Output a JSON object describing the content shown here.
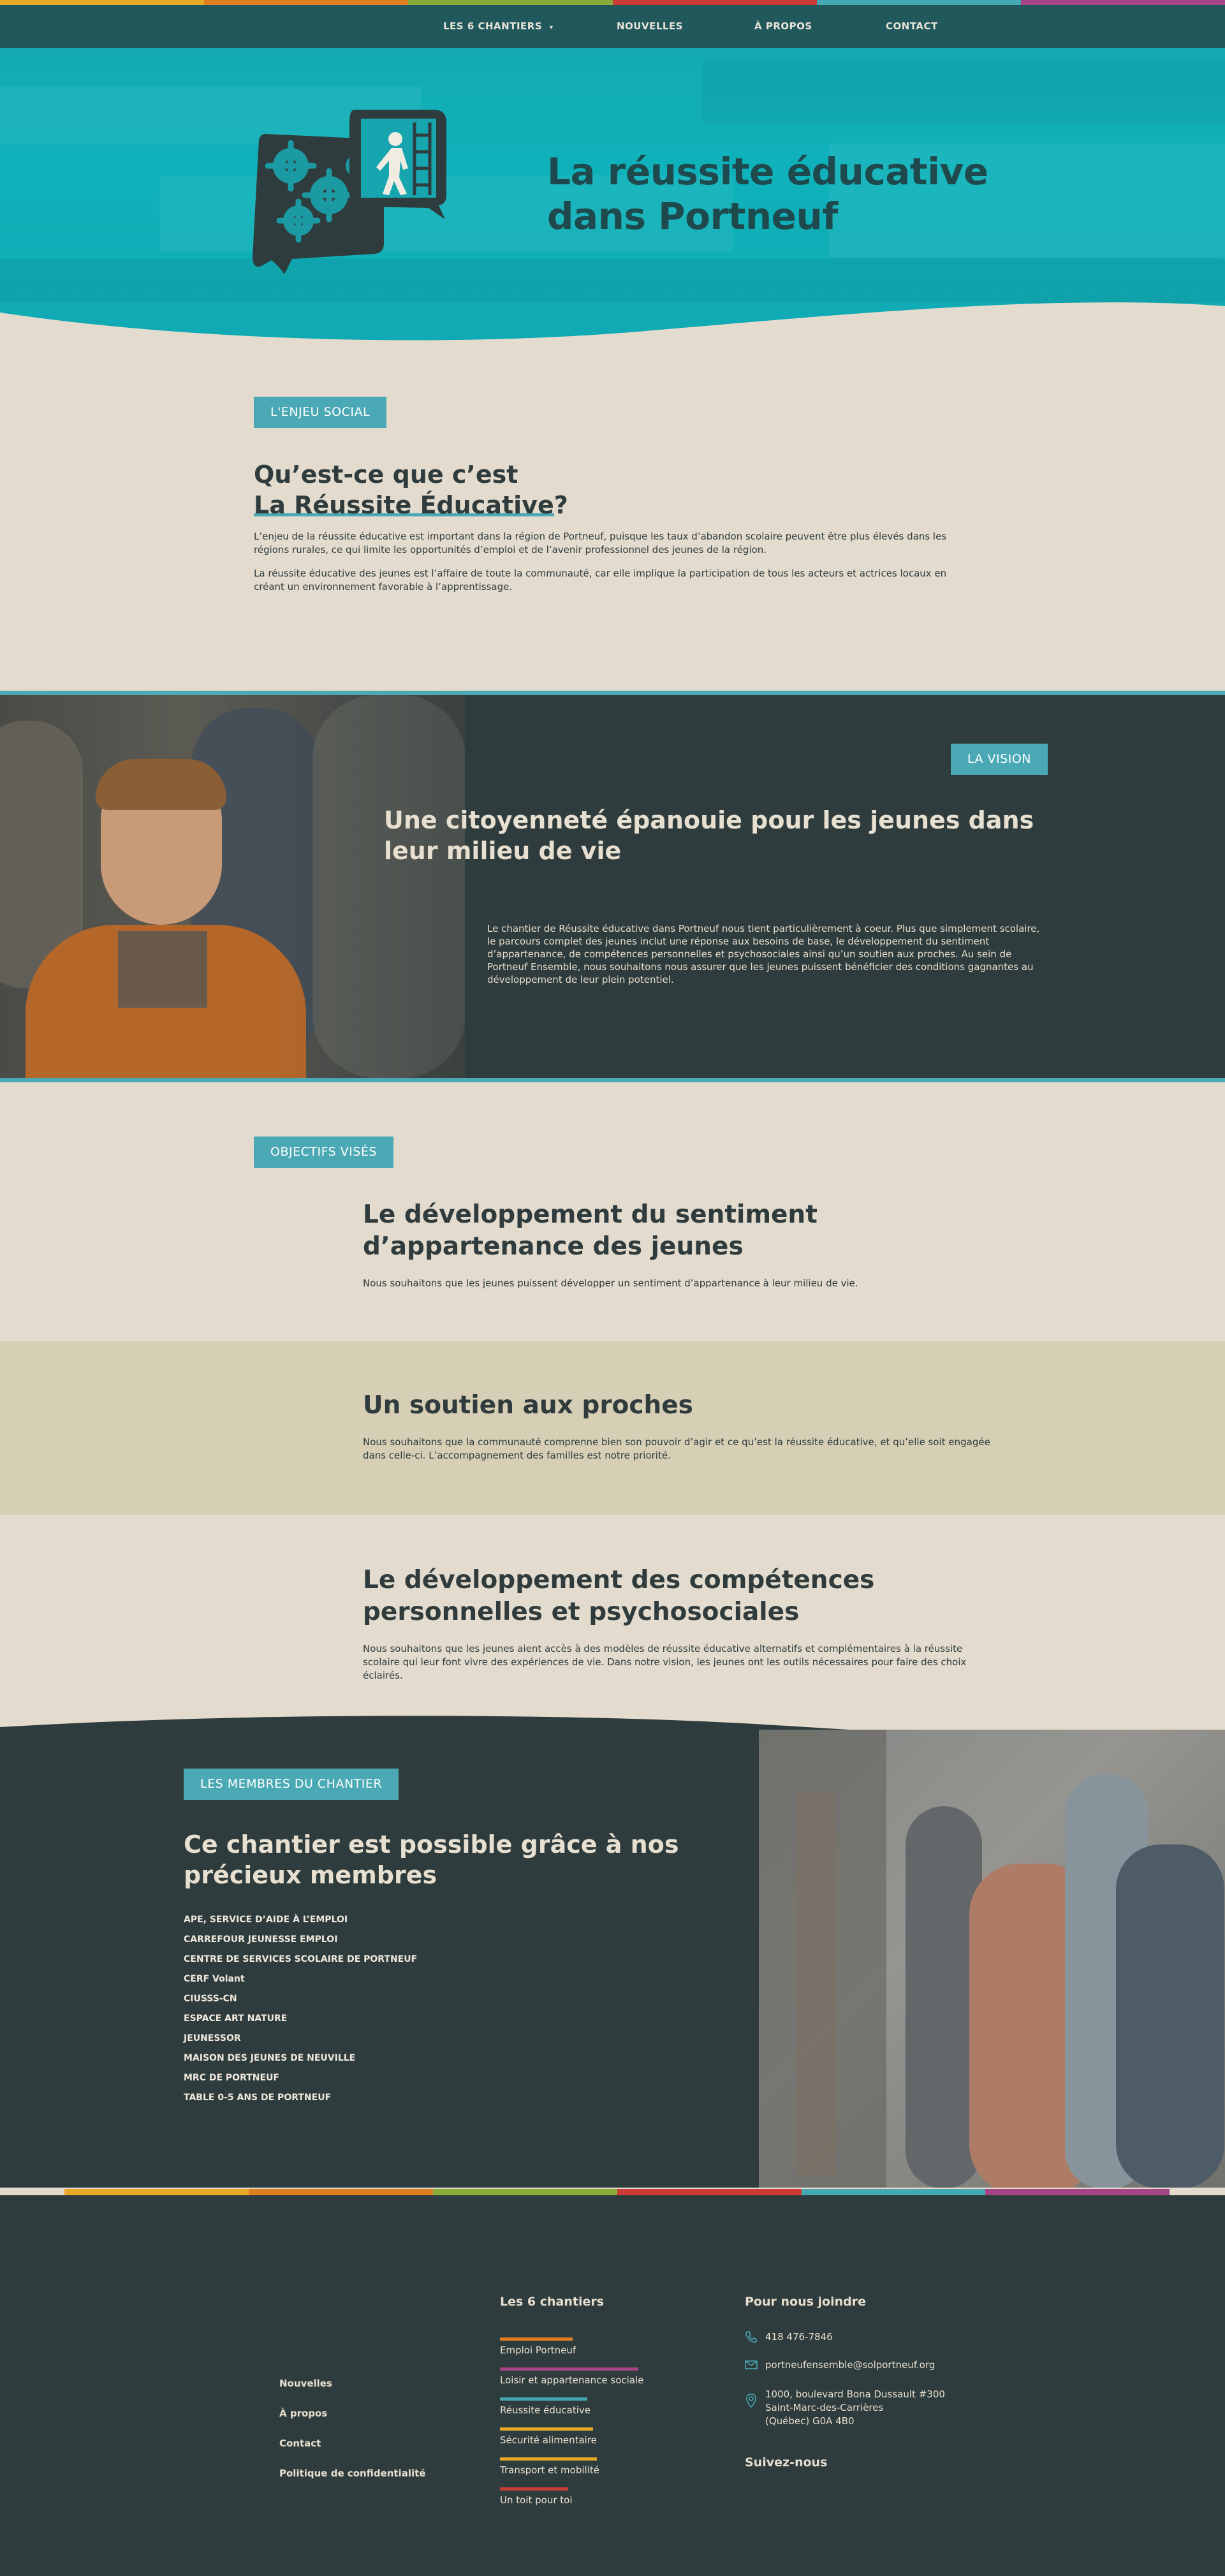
{
  "colors": {
    "stripe": [
      "#e9a928",
      "#e07f22",
      "#8aab3a",
      "#cc3b36",
      "#45a9b4",
      "#a54585"
    ],
    "teal": "#4aa9b4",
    "dark": "#2f3c3d",
    "beige": "#e3dbcd"
  },
  "nav": {
    "items": [
      {
        "label": "LES 6 CHANTIERS",
        "has_dropdown": true
      },
      {
        "label": "NOUVELLES"
      },
      {
        "label": "À PROPOS"
      },
      {
        "label": "CONTACT"
      }
    ]
  },
  "hero": {
    "logo_icon": "speech-bubbles-gears-ladder-icon",
    "title_line1": "La réussite éducative",
    "title_line2": "dans Portneuf"
  },
  "enjeu": {
    "tag": "L'ENJEU SOCIAL",
    "title_line1": "Qu’est-ce que c’est",
    "title_line2_highlight": "La Réussite Éducative",
    "title_line2_end": "?",
    "p1": "L’enjeu de la réussite éducative est important dans la région de Portneuf, puisque les taux d’abandon scolaire peuvent être plus élevés dans les régions rurales, ce qui limite les opportunités d’emploi et de l’avenir professionnel des jeunes de la région.",
    "p2": "La réussite éducative des jeunes est l’affaire de toute la communauté, car elle implique la participation de tous les acteurs et actrices locaux en créant un environnement favorable à l’apprentissage."
  },
  "vision": {
    "tag": "LA VISION",
    "title": "Une citoyenneté épanouie pour les jeunes dans leur milieu de vie",
    "body": "Le chantier de Réussite éducative dans Portneuf nous tient particulièrement à coeur. Plus que simplement scolaire, le parcours complet des jeunes inclut une réponse aux besoins de base, le développement du sentiment d’appartenance, de compétences personnelles et psychosociales ainsi qu’un soutien aux proches. Au sein de Portneuf Ensemble, nous souhaitons nous assurer que les jeunes puissent bénéficier des conditions gagnantes au développement de leur plein potentiel."
  },
  "objectifs": {
    "tag": "OBJECTIFS VISÉS",
    "items": [
      {
        "title": "Le développement du sentiment d’appartenance des jeunes",
        "body": "Nous souhaitons que les jeunes puissent développer un sentiment d’appartenance à leur milieu de vie."
      },
      {
        "title": "Un soutien aux proches",
        "body": "Nous souhaitons que la communauté comprenne bien son pouvoir d’agir et ce qu’est la réussite éducative, et qu’elle soit engagée dans celle-ci. L’accompagnement des familles est notre priorité."
      },
      {
        "title": "Le développement des compétences personnelles et psychosociales",
        "body": "Nous souhaitons que les jeunes aient accès à des modèles de réussite éducative alternatifs et complémentaires à la réussite scolaire qui leur font vivre des expériences de vie. Dans notre vision, les jeunes ont les outils nécessaires pour faire des choix éclairés."
      }
    ]
  },
  "membres": {
    "tag": "LES MEMBRES DU CHANTIER",
    "title": "Ce chantier est possible grâce à nos précieux membres",
    "list": [
      "APE, SERVICE D’AIDE À L’EMPLOI",
      "CARREFOUR JEUNESSE EMPLOI",
      "CENTRE DE SERVICES SCOLAIRE DE PORTNEUF",
      "CERF Volant",
      "CIUSSS-CN",
      "ESPACE ART NATURE",
      "JEUNESSOR",
      "MAISON DES JEUNES DE NEUVILLE",
      "MRC DE PORTNEUF",
      "TABLE 0-5 ANS DE PORTNEUF"
    ]
  },
  "footer": {
    "links": [
      "Nouvelles",
      "À propos",
      "Contact",
      "Politique de confidentialité"
    ],
    "chantiers_title": "Les 6 chantiers",
    "chantiers": [
      {
        "label": "Emploi Portneuf",
        "color": "#e07f22"
      },
      {
        "label": "Loisir et appartenance sociale",
        "color": "#a54585"
      },
      {
        "label": "Réussite éducative",
        "color": "#45a9b4"
      },
      {
        "label": "Sécurité alimentaire",
        "color": "#e9a928"
      },
      {
        "label": "Transport et mobilité",
        "color": "#e9a928"
      },
      {
        "label": "Un toit pour toi",
        "color": "#cc3b36"
      }
    ],
    "contact_title": "Pour nous joindre",
    "phone": "418 476-7846",
    "email": "portneufensemble@solportneuf.org",
    "address_line1": "1000, boulevard Bona Dussault #300",
    "address_line2": "Saint-Marc-des-Carrières",
    "address_line3": "(Québec) G0A 4B0",
    "follow_title": "Suivez-nous"
  }
}
